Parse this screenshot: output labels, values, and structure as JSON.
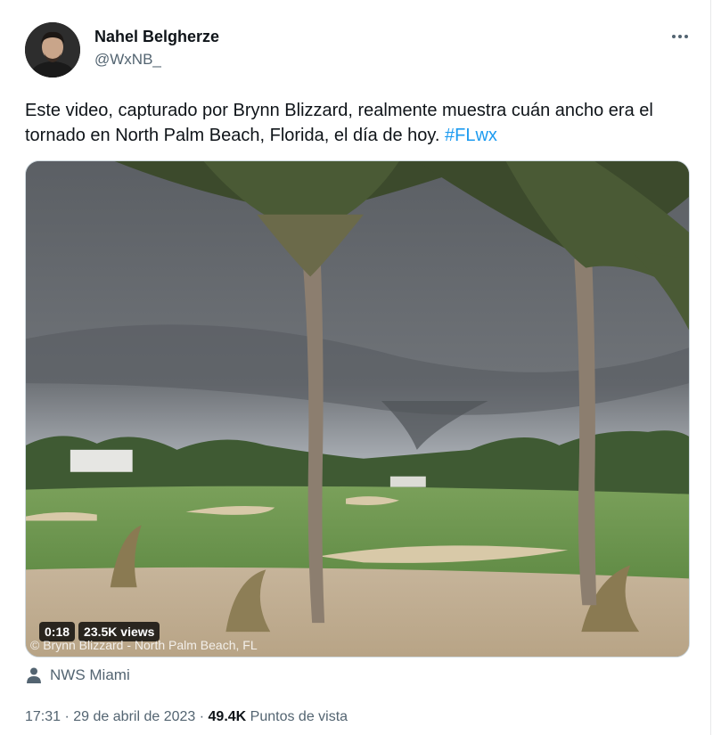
{
  "author": {
    "name": "Nahel Belgherze",
    "handle": "@WxNB_"
  },
  "tweet": {
    "text": "Este video, capturado por Brynn Blizzard, realmente muestra cuán ancho era el tornado en North Palm Beach, Florida, el día de hoy.",
    "hashtag": "#FLwx"
  },
  "media": {
    "duration": "0:18",
    "views": "23.5K views",
    "watermark": "© Brynn Blizzard - North Palm Beach, FL"
  },
  "source": {
    "label": "NWS Miami"
  },
  "meta": {
    "time": "17:31",
    "separator": "·",
    "date": "29 de abril de 2023",
    "views_count": "49.4K",
    "views_label": "Puntos de vista"
  },
  "icons": {
    "more": "more-icon",
    "source": "person-icon"
  },
  "colors": {
    "link": "#1d9bf0",
    "secondary_text": "#536471",
    "primary_text": "#0f1419"
  }
}
